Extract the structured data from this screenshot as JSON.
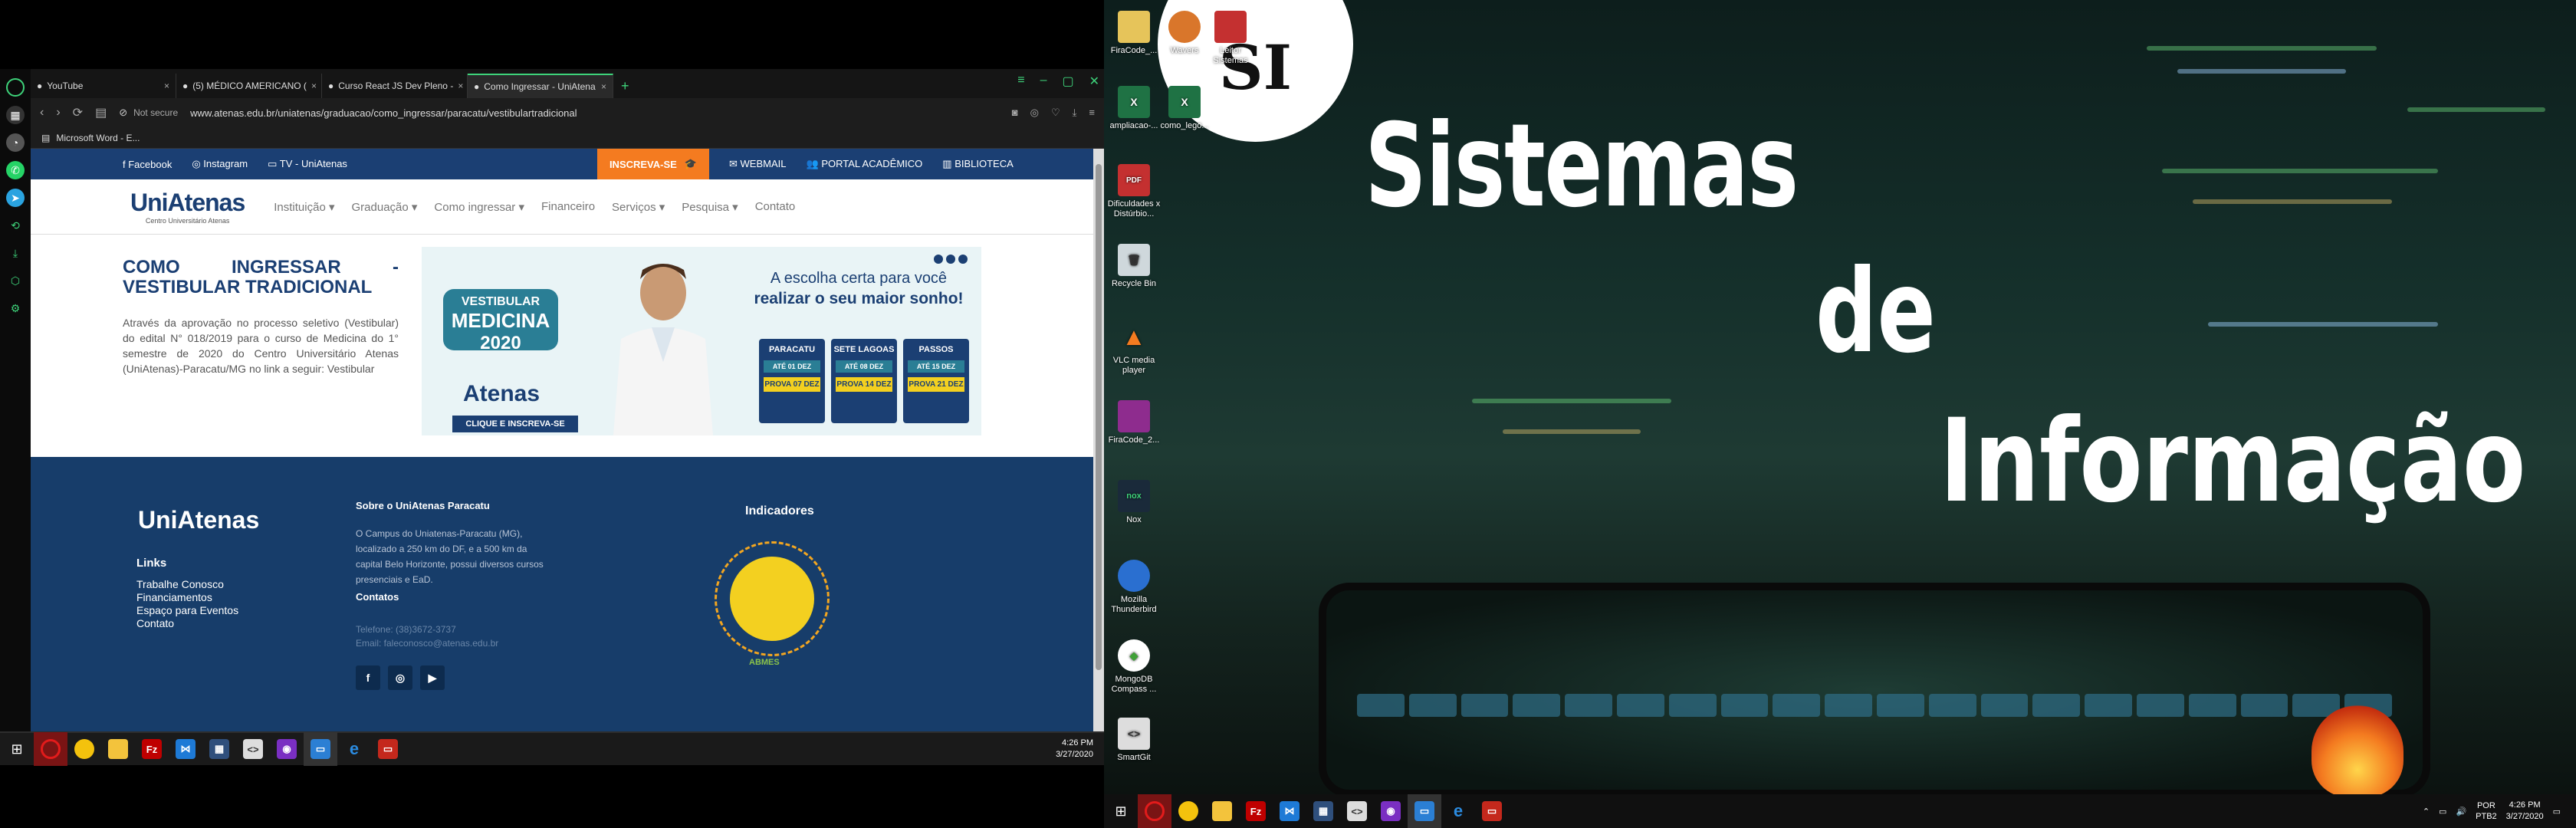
{
  "browser": {
    "tabs": [
      {
        "label": "YouTube",
        "active": false
      },
      {
        "label": "(5) MÉDICO AMERICANO (",
        "active": false
      },
      {
        "label": "Curso React JS Dev Pleno -",
        "active": false
      },
      {
        "label": "Como Ingressar - UniAtena",
        "active": true
      }
    ],
    "new_tab": "+",
    "security": "Not secure",
    "url": "www.atenas.edu.br/uniatenas/graduacao/como_ingressar/paracatu/vestibulartradicional",
    "bookmark": "Microsoft Word - E..."
  },
  "site": {
    "topbar": {
      "facebook": "Facebook",
      "instagram": "Instagram",
      "tv": "TV - UniAtenas",
      "inscreva": "INSCREVA-SE",
      "webmail": "WEBMAIL",
      "portal": "PORTAL ACADÊMICO",
      "biblioteca": "BIBLIOTECA"
    },
    "logo": {
      "main": "UniAtenas",
      "sub": "Centro Universitário Atenas"
    },
    "nav": [
      "Instituição",
      "Graduação",
      "Como ingressar",
      "Financeiro",
      "Serviços",
      "Pesquisa",
      "Contato"
    ],
    "title": "COMO INGRESSAR - VESTIBULAR TRADICIONAL",
    "description": "Através da aprovação no processo seletivo (Vestibular) do edital N° 018/2019 para o curso de Medicina do 1° semestre de 2020 do Centro Universitário Atenas (UniAtenas)-Paracatu/MG no link a seguir: Vestibular",
    "banner": {
      "vest1": "VESTIBULAR",
      "vest2": "MEDICINA",
      "vest3": "2020",
      "slogan1": "A escolha certa para você",
      "slogan2": "realizar o seu maior sonho!",
      "logo": "Atenas",
      "cta": "CLIQUE E INSCREVA-SE",
      "cities": [
        {
          "name": "PARACATU",
          "dates": "ATÉ 01 DEZ",
          "prova": "PROVA 07 DEZ"
        },
        {
          "name": "SETE LAGOAS",
          "dates": "ATÉ 08 DEZ",
          "prova": "PROVA 14 DEZ"
        },
        {
          "name": "PASSOS",
          "dates": "ATÉ 15 DEZ",
          "prova": "PROVA 21 DEZ"
        }
      ]
    },
    "footer": {
      "logo": "UniAtenas",
      "links_title": "Links",
      "links": [
        "Trabalhe Conosco",
        "Financiamentos",
        "Espaço para Eventos",
        "Contato"
      ],
      "sobre_title": "Sobre o UniAtenas Paracatu",
      "sobre": "O Campus do Uniatenas-Paracatu (MG), localizado a 250 km do DF, e a 500 km da capital Belo Horizonte, possui diversos cursos presenciais e EaD.",
      "contatos_title": "Contatos",
      "telefone": "Telefone: (38)3672-3737",
      "email": "Email: faleconosco@atenas.edu.br",
      "indicadores_title": "Indicadores",
      "abmes": "ABMES"
    }
  },
  "taskbar_left": {
    "time": "4:26 PM",
    "date": "3/27/2020"
  },
  "taskbar_right": {
    "lang": "POR",
    "layout": "PTB2",
    "time": "4:26 PM",
    "date": "3/27/2020"
  },
  "desktop": {
    "icons": [
      {
        "label": "FiraCode_...",
        "col": 0
      },
      {
        "label": "Wavers",
        "col": 1
      },
      {
        "label": "Leitor Sistemas",
        "col": 2
      },
      {
        "label": "ampliacao-...",
        "col": 0
      },
      {
        "label": "como_lego...",
        "col": 1
      },
      {
        "label": "Dificuldades x Distúrbio...",
        "col": 0
      },
      {
        "label": "Recycle Bin",
        "col": 0
      },
      {
        "label": "VLC media player",
        "col": 0
      },
      {
        "label": "FiraCode_2...",
        "col": 0
      },
      {
        "label": "Nox",
        "col": 0
      },
      {
        "label": "Mozilla Thunderbird",
        "col": 0
      },
      {
        "label": "MongoDB Compass ...",
        "col": 0
      },
      {
        "label": "SmartGit",
        "col": 0
      }
    ],
    "wallpaper": {
      "line1": "Sistemas",
      "line2": "de",
      "line3": "Informação",
      "logo": "SI"
    }
  },
  "colors": {
    "accent": "#3ed37a",
    "brand_blue": "#1b3f73",
    "brand_orange": "#f47b20",
    "footer_bg": "#173d6a"
  }
}
